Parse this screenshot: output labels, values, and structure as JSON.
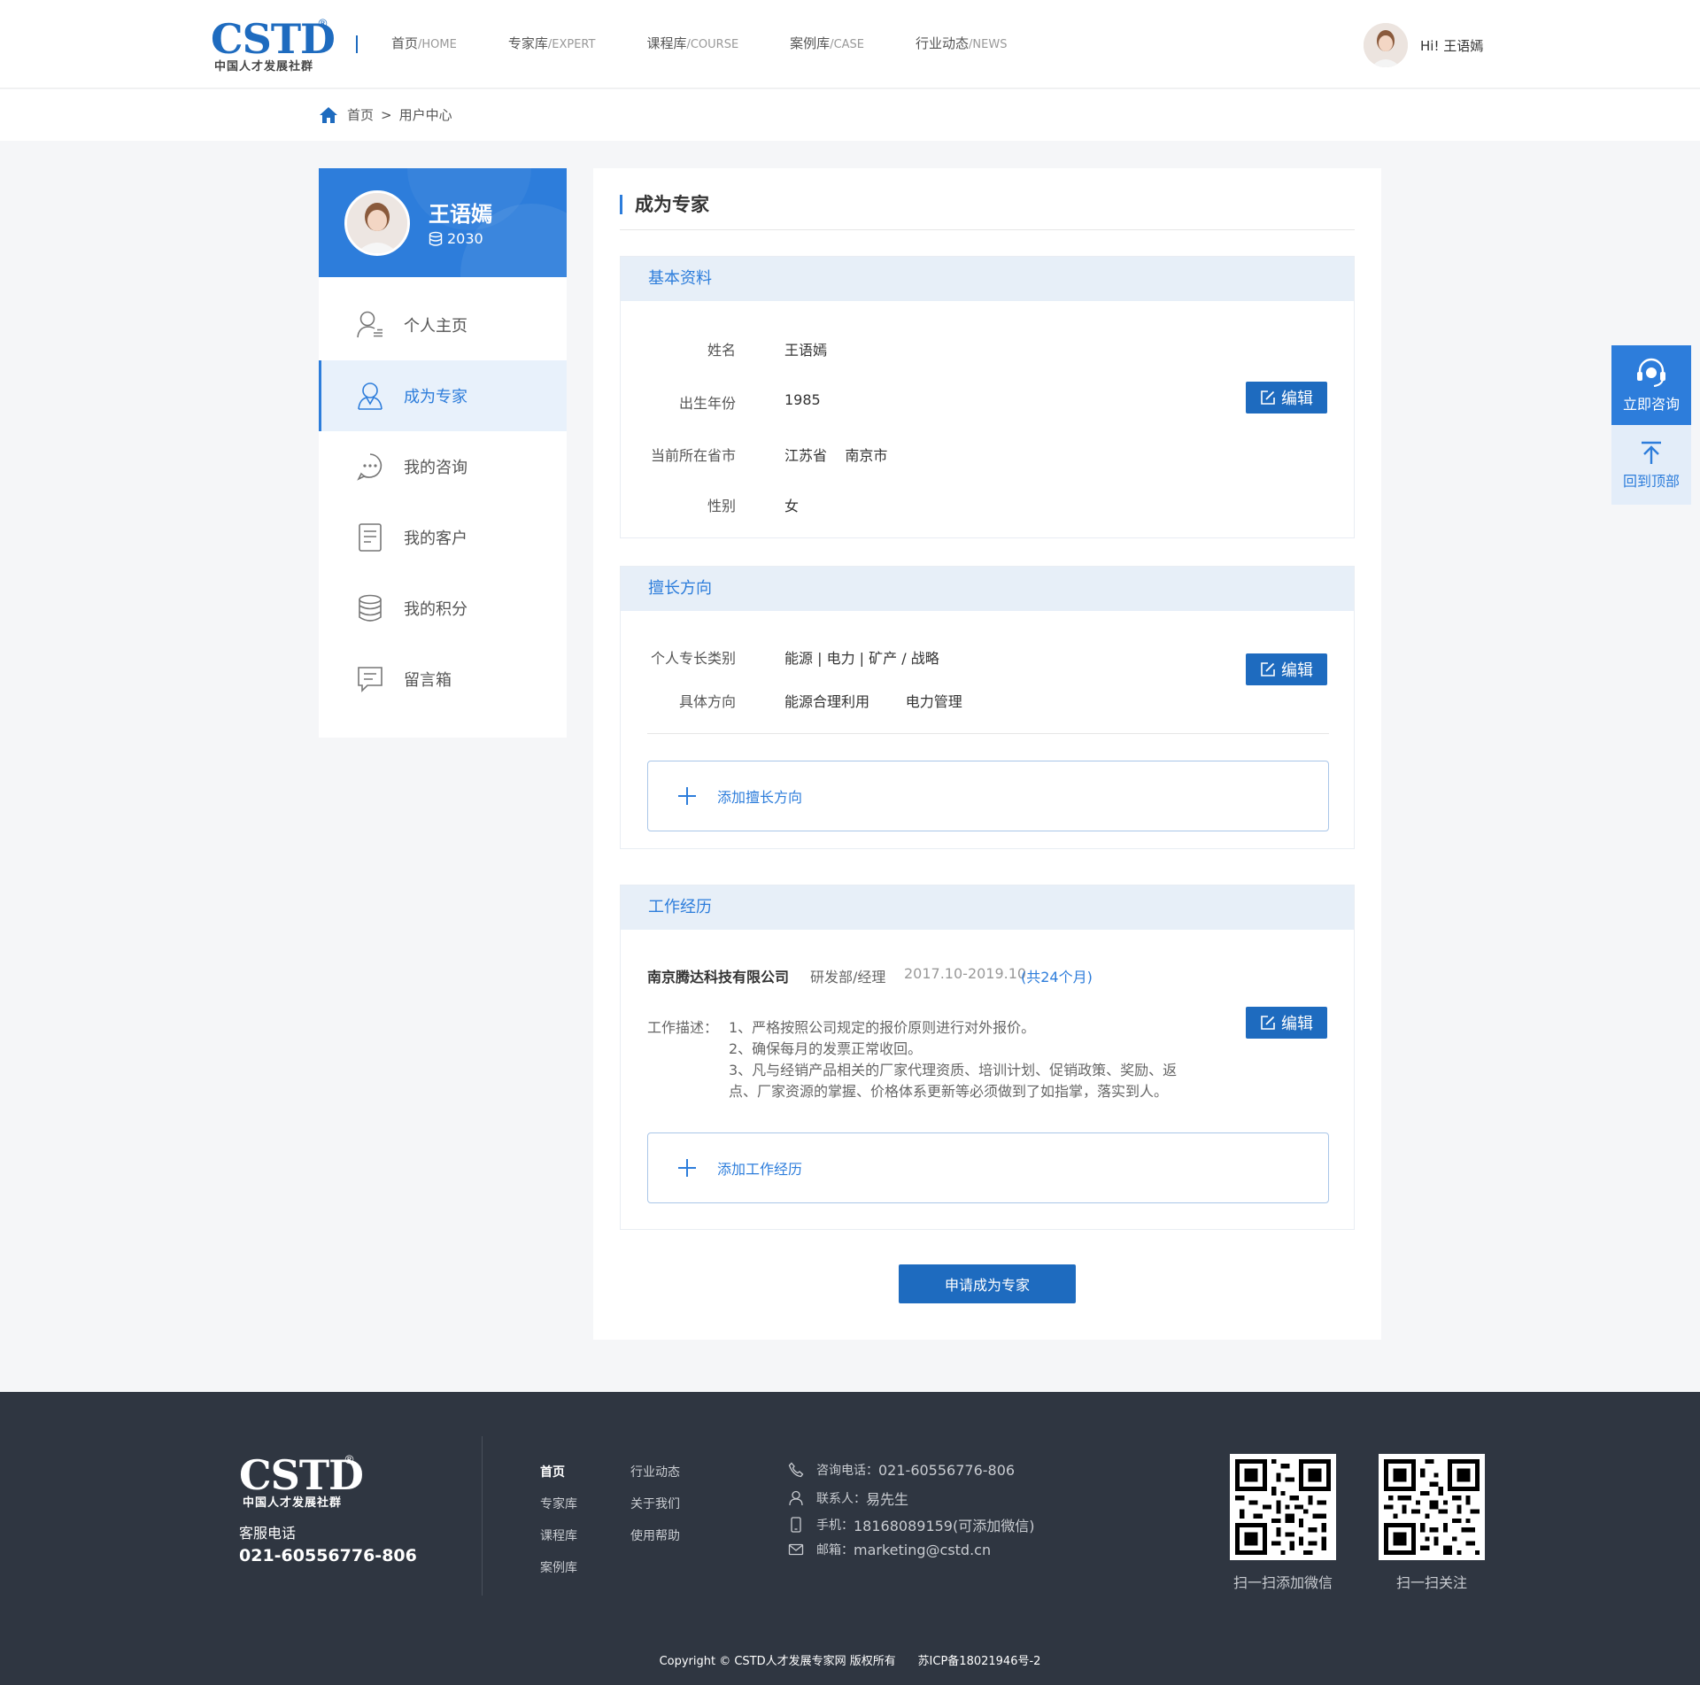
{
  "header": {
    "logo_text": "CSTD",
    "logo_reg": "®",
    "logo_sub": "中国人才发展社群",
    "nav": [
      {
        "cn": "首页",
        "en": "/HOME"
      },
      {
        "cn": "专家库",
        "en": "/EXPERT"
      },
      {
        "cn": "课程库",
        "en": "/COURSE"
      },
      {
        "cn": "案例库",
        "en": "/CASE"
      },
      {
        "cn": "行业动态",
        "en": "/NEWS"
      }
    ],
    "greeting": "Hi! 王语嫣"
  },
  "breadcrumb": {
    "home": "首页",
    "sep": ">",
    "current": "用户中心"
  },
  "sidebar": {
    "name": "王语嫣",
    "points": "2030",
    "items": [
      {
        "label": "个人主页",
        "icon": "user-profile-icon"
      },
      {
        "label": "成为专家",
        "icon": "expert-icon"
      },
      {
        "label": "我的咨询",
        "icon": "chat-icon"
      },
      {
        "label": "我的客户",
        "icon": "document-icon"
      },
      {
        "label": "我的积分",
        "icon": "database-icon"
      },
      {
        "label": "留言箱",
        "icon": "message-icon"
      }
    ],
    "active_index": 1
  },
  "main": {
    "title": "成为专家",
    "basic": {
      "heading": "基本资料",
      "fields": [
        {
          "label": "姓名",
          "value": "王语嫣"
        },
        {
          "label": "出生年份",
          "value": "1985"
        },
        {
          "label": "当前所在省市",
          "value": "江苏省    南京市"
        },
        {
          "label": "性别",
          "value": "女"
        }
      ]
    },
    "expertise": {
      "heading": "擅长方向",
      "fields": [
        {
          "label": "个人专长类别",
          "value": "能源 | 电力 | 矿产 / 战略"
        },
        {
          "label": "具体方向",
          "value": "能源合理利用        电力管理"
        }
      ],
      "add_label": "添加擅长方向"
    },
    "work": {
      "heading": "工作经历",
      "company": "南京腾达科技有限公司",
      "position": "研发部/经理",
      "period": "2017.10-2019.10",
      "duration": "(共24个月)",
      "desc_label": "工作描述：",
      "desc_lines": [
        "1、严格按照公司规定的报价原则进行对外报价。",
        "2、确保每月的发票正常收回。",
        "3、凡与经销产品相关的厂家代理资质、培训计划、促销政策、奖励、返",
        "点、厂家资源的掌握、价格体系更新等必须做到了如指掌，落实到人。"
      ],
      "add_label": "添加工作经历"
    },
    "edit_label": "编辑",
    "apply_label": "申请成为专家"
  },
  "float": {
    "consult": "立即咨询",
    "top": "回到顶部"
  },
  "footer": {
    "service_label": "客服电话",
    "service_phone": "021-60556776-806",
    "links_col1": [
      "首页",
      "专家库",
      "课程库",
      "案例库"
    ],
    "links_col2": [
      "行业动态",
      "关于我们",
      "使用帮助"
    ],
    "contacts": [
      {
        "key": "咨询电话：",
        "value": "021-60556776-806",
        "icon": "phone-icon"
      },
      {
        "key": "联系人：",
        "value": "易先生",
        "icon": "person-icon"
      },
      {
        "key": "手机：",
        "value": "18168089159(可添加微信)",
        "icon": "mobile-icon"
      },
      {
        "key": "邮箱：",
        "value": "marketing@cstd.cn",
        "icon": "mail-icon"
      }
    ],
    "qr1_label": "扫一扫添加微信",
    "qr2_label": "扫一扫关注",
    "copyright": "Copyright © CSTD人才发展专家网 版权所有      苏ICP备18021946号-2"
  },
  "colors": {
    "primary": "#2d7ddb",
    "primary_dark": "#1e6bbf",
    "footer_bg": "#2f3641",
    "section_head_bg": "#e7eff8"
  }
}
